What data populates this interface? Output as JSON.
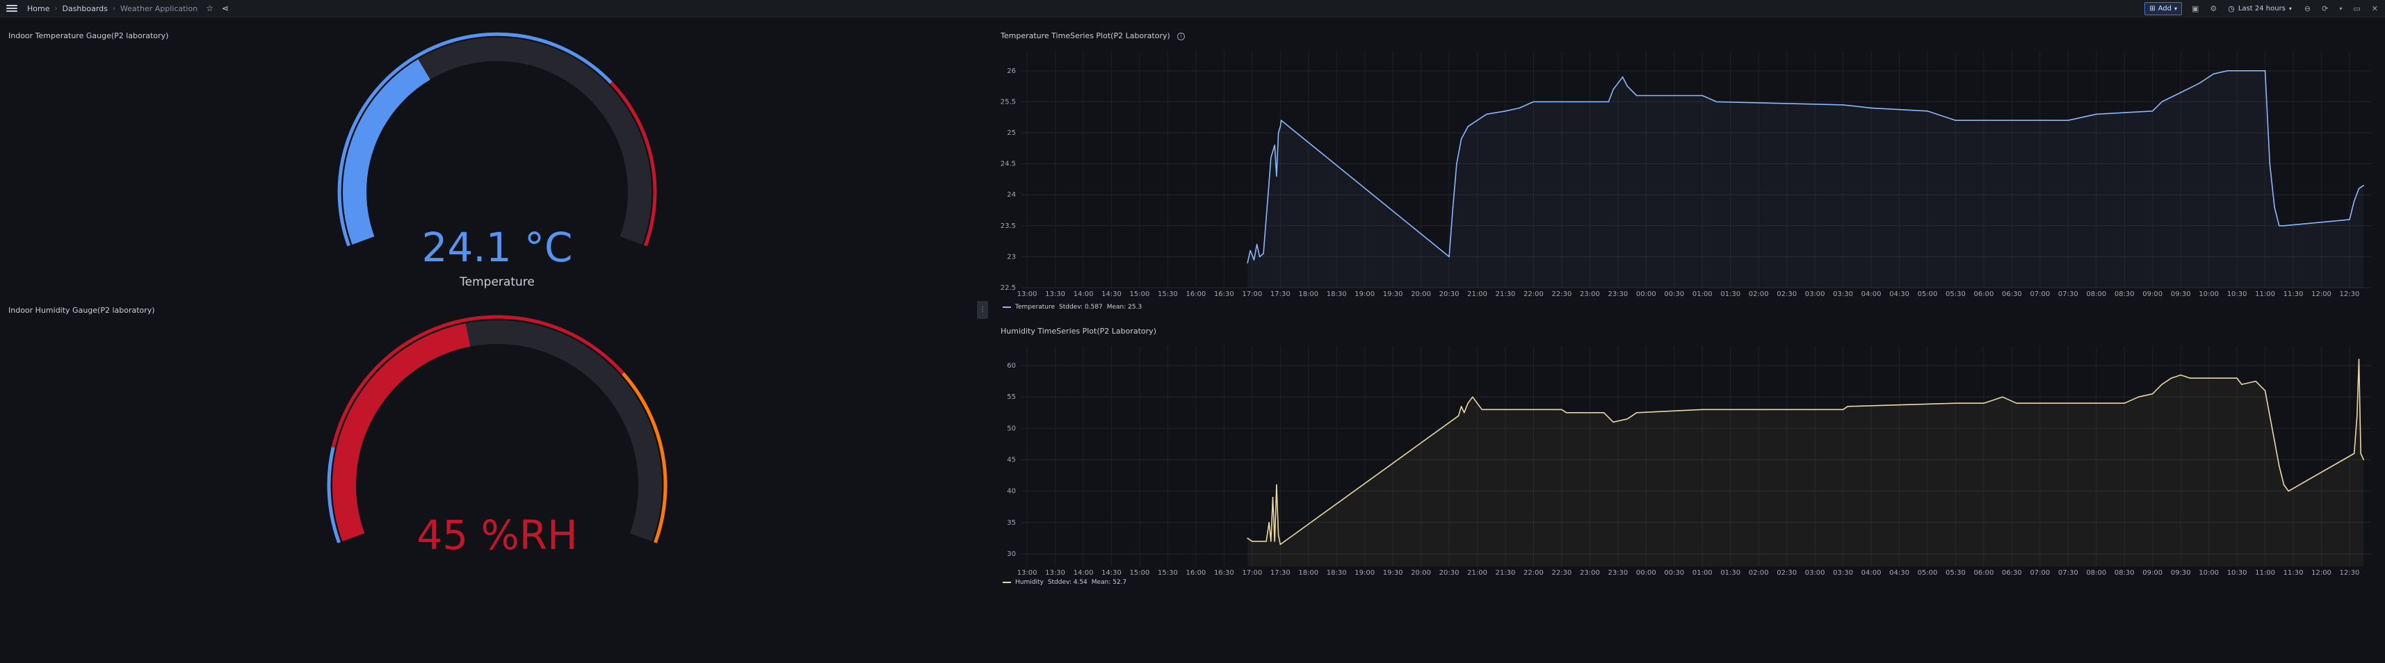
{
  "topbar": {
    "breadcrumbs": [
      "Home",
      "Dashboards",
      "Weather Application"
    ],
    "add_label": "Add",
    "time_range": "Last 24 hours",
    "icons": [
      "menu-icon",
      "star-icon",
      "share-icon",
      "save-icon",
      "settings-icon",
      "clock-icon",
      "zoom-out-icon",
      "refresh-icon",
      "tv-mode-icon",
      "close-icon"
    ]
  },
  "gauges": {
    "temperature": {
      "title": "Indoor Temperature Gauge(P2 laboratory)",
      "value_text": "24.1 °C",
      "label": "Temperature",
      "fraction": 0.36,
      "value_color": "#5794f2"
    },
    "humidity": {
      "title": "Indoor Humidity Gauge(P2 laboratory)",
      "value_text": "45 %RH",
      "label": "",
      "fraction": 0.45,
      "value_color": "#c4162a"
    }
  },
  "colors": {
    "blue": "#5794f2",
    "red": "#c4162a",
    "orange": "#ff780a",
    "track": "#26272e",
    "temp_line": "#8ab8ff",
    "hum_line": "#e9d8a6"
  },
  "charts": {
    "temperature": {
      "title": "Temperature TimeSeries Plot(P2 Laboratory)",
      "legend_name": "Temperature",
      "stddev": "Stddev: 0.587",
      "mean": "Mean: 25.3"
    },
    "humidity": {
      "title": "Humidity TimeSeries Plot(P2 Laboratory)",
      "legend_name": "Humidity",
      "stddev": "Stddev: 4.54",
      "mean": "Mean: 52.7"
    }
  },
  "chart_data": [
    {
      "type": "line",
      "title": "Temperature TimeSeries Plot(P2 Laboratory)",
      "y_ticks": [
        "26",
        "25.5",
        "25",
        "24.5",
        "24",
        "23.5",
        "23",
        "22.5"
      ],
      "ylim": [
        22.5,
        26.2
      ],
      "x_ticks": [
        "13:00",
        "13:30",
        "14:00",
        "14:30",
        "15:00",
        "15:30",
        "16:00",
        "16:30",
        "17:00",
        "17:30",
        "18:00",
        "18:30",
        "19:00",
        "19:30",
        "20:00",
        "20:30",
        "21:00",
        "21:30",
        "22:00",
        "22:30",
        "23:00",
        "23:30",
        "00:00",
        "00:30",
        "01:00",
        "01:30",
        "02:00",
        "02:30",
        "03:00",
        "03:30",
        "04:00",
        "04:30",
        "05:00",
        "05:30",
        "06:00",
        "06:30",
        "07:00",
        "07:30",
        "08:00",
        "08:30",
        "09:00",
        "09:30",
        "10:00",
        "10:30",
        "11:00",
        "11:30",
        "12:00",
        "12:30"
      ],
      "series": [
        {
          "name": "Temperature",
          "points": [
            [
              "16:55",
              22.9
            ],
            [
              "16:58",
              23.1
            ],
            [
              "17:02",
              22.95
            ],
            [
              "17:05",
              23.2
            ],
            [
              "17:08",
              23.0
            ],
            [
              "17:12",
              23.05
            ],
            [
              "17:18",
              24.2
            ],
            [
              "17:20",
              24.6
            ],
            [
              "17:24",
              24.8
            ],
            [
              "17:26",
              24.3
            ],
            [
              "17:28",
              25.0
            ],
            [
              "17:30",
              25.1
            ],
            [
              "17:31",
              25.2
            ],
            [
              "20:30",
              23.0
            ],
            [
              "20:34",
              23.8
            ],
            [
              "20:38",
              24.5
            ],
            [
              "20:43",
              24.9
            ],
            [
              "20:50",
              25.1
            ],
            [
              "21:00",
              25.2
            ],
            [
              "21:10",
              25.3
            ],
            [
              "21:30",
              25.35
            ],
            [
              "21:45",
              25.4
            ],
            [
              "22:00",
              25.5
            ],
            [
              "23:20",
              25.5
            ],
            [
              "23:25",
              25.7
            ],
            [
              "23:30",
              25.8
            ],
            [
              "23:35",
              25.9
            ],
            [
              "23:40",
              25.75
            ],
            [
              "23:50",
              25.6
            ],
            [
              "01:00",
              25.6
            ],
            [
              "01:15",
              25.5
            ],
            [
              "03:30",
              25.45
            ],
            [
              "04:00",
              25.4
            ],
            [
              "05:00",
              25.35
            ],
            [
              "05:30",
              25.2
            ],
            [
              "07:30",
              25.2
            ],
            [
              "08:00",
              25.3
            ],
            [
              "09:00",
              25.35
            ],
            [
              "09:10",
              25.5
            ],
            [
              "09:30",
              25.65
            ],
            [
              "09:50",
              25.8
            ],
            [
              "10:05",
              25.95
            ],
            [
              "10:20",
              26.0
            ],
            [
              "11:00",
              26.0
            ],
            [
              "11:05",
              24.5
            ],
            [
              "11:10",
              23.8
            ],
            [
              "11:15",
              23.5
            ],
            [
              "11:20",
              23.5
            ],
            [
              "12:30",
              23.6
            ],
            [
              "12:35",
              23.9
            ],
            [
              "12:40",
              24.1
            ],
            [
              "12:45",
              24.15
            ]
          ]
        }
      ]
    },
    {
      "type": "line",
      "title": "Humidity TimeSeries Plot(P2 Laboratory)",
      "y_ticks": [
        "60",
        "55",
        "50",
        "45",
        "40",
        "35",
        "30"
      ],
      "ylim": [
        28,
        62
      ],
      "x_ticks": [
        "13:00",
        "13:30",
        "14:00",
        "14:30",
        "15:00",
        "15:30",
        "16:00",
        "16:30",
        "17:00",
        "17:30",
        "18:00",
        "18:30",
        "19:00",
        "19:30",
        "20:00",
        "20:30",
        "21:00",
        "21:30",
        "22:00",
        "22:30",
        "23:00",
        "23:30",
        "00:00",
        "00:30",
        "01:00",
        "01:30",
        "02:00",
        "02:30",
        "03:00",
        "03:30",
        "04:00",
        "04:30",
        "05:00",
        "05:30",
        "06:00",
        "06:30",
        "07:00",
        "07:30",
        "08:00",
        "08:30",
        "09:00",
        "09:30",
        "10:00",
        "10:30",
        "11:00",
        "11:30",
        "12:00",
        "12:30"
      ],
      "series": [
        {
          "name": "Humidity",
          "points": [
            [
              "16:55",
              32.5
            ],
            [
              "17:00",
              32
            ],
            [
              "17:15",
              32
            ],
            [
              "17:18",
              35
            ],
            [
              "17:20",
              32
            ],
            [
              "17:22",
              39
            ],
            [
              "17:24",
              32
            ],
            [
              "17:26",
              41
            ],
            [
              "17:28",
              33
            ],
            [
              "17:30",
              31.5
            ],
            [
              "20:40",
              52
            ],
            [
              "20:43",
              53.5
            ],
            [
              "20:46",
              52.5
            ],
            [
              "20:50",
              54
            ],
            [
              "20:55",
              55
            ],
            [
              "21:00",
              54
            ],
            [
              "21:05",
              53
            ],
            [
              "22:30",
              53
            ],
            [
              "22:35",
              52.5
            ],
            [
              "23:15",
              52.5
            ],
            [
              "23:25",
              51
            ],
            [
              "23:40",
              51.5
            ],
            [
              "23:50",
              52.5
            ],
            [
              "01:00",
              53
            ],
            [
              "03:30",
              53
            ],
            [
              "03:35",
              53.5
            ],
            [
              "05:30",
              54
            ],
            [
              "06:00",
              54
            ],
            [
              "06:20",
              55
            ],
            [
              "06:35",
              54
            ],
            [
              "08:30",
              54
            ],
            [
              "08:45",
              55
            ],
            [
              "09:00",
              55.5
            ],
            [
              "09:10",
              57
            ],
            [
              "09:20",
              58
            ],
            [
              "09:30",
              58.5
            ],
            [
              "09:40",
              58
            ],
            [
              "10:30",
              58
            ],
            [
              "10:35",
              57
            ],
            [
              "10:50",
              57.5
            ],
            [
              "11:00",
              56
            ],
            [
              "11:05",
              52
            ],
            [
              "11:10",
              48
            ],
            [
              "11:15",
              44
            ],
            [
              "11:20",
              41
            ],
            [
              "11:25",
              40
            ],
            [
              "12:35",
              46
            ],
            [
              "12:38",
              52
            ],
            [
              "12:40",
              61
            ],
            [
              "12:42",
              46
            ],
            [
              "12:45",
              45
            ]
          ]
        }
      ]
    }
  ]
}
